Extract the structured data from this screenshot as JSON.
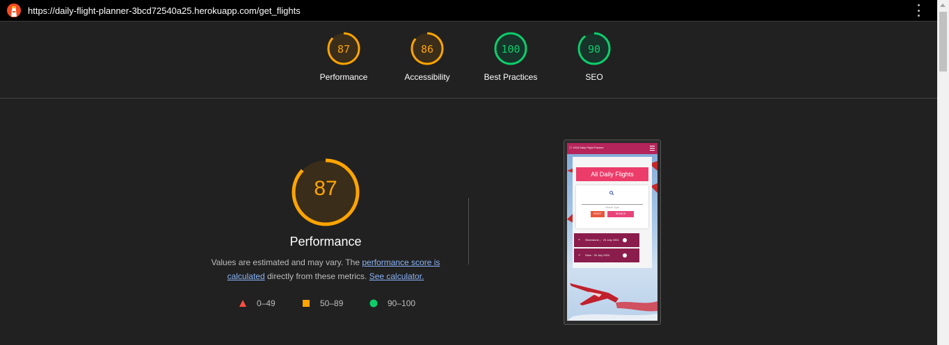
{
  "browser": {
    "url": "https://daily-flight-planner-3bcd72540a25.herokuapp.com/get_flights",
    "menu_icon": "kebab-menu-icon"
  },
  "summary_scores": [
    {
      "label": "Performance",
      "score": "87",
      "color": "#ffa400"
    },
    {
      "label": "Accessibility",
      "score": "86",
      "color": "#ffa400"
    },
    {
      "label": "Best Practices",
      "score": "100",
      "color": "#0cce6b"
    },
    {
      "label": "SEO",
      "score": "90",
      "color": "#0cce6b"
    }
  ],
  "performance": {
    "score": "87",
    "title": "Performance",
    "desc_prefix": "Values are estimated and may vary. The ",
    "link_score": "performance score is calculated",
    "desc_middle": " directly from these metrics. ",
    "link_calc": "See calculator."
  },
  "legend": [
    {
      "label": "0–49",
      "shape": "triangle",
      "color": "#ff4e42"
    },
    {
      "label": "50–89",
      "shape": "square",
      "color": "#ffa400"
    },
    {
      "label": "90–100",
      "shape": "circle",
      "color": "#0cce6b"
    }
  ],
  "phone_preview": {
    "brand": "ⓢ 1918 Daily Flight Planner",
    "title": "All Daily Flights",
    "search_hint": "Search Type",
    "reset_label": "RESET",
    "search_label": "SEARCH",
    "rows": [
      "Silverstone ₁ · 23 July 2024",
      "Stow · 25 July 2024"
    ]
  }
}
